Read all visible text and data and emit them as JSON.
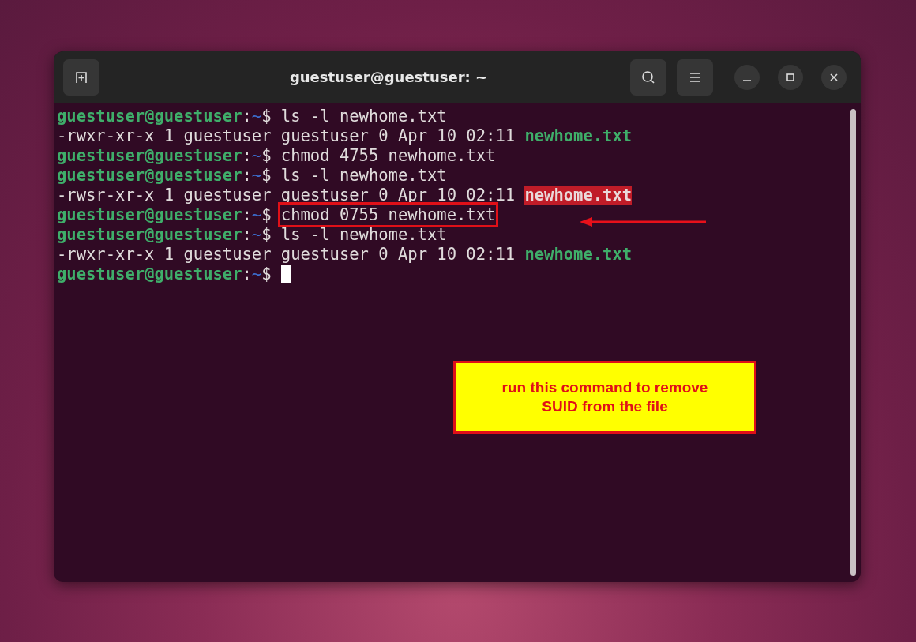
{
  "window": {
    "title": "guestuser@guestuser: ~"
  },
  "terminal": {
    "lines": [
      {
        "kind": "prompt",
        "prompt": {
          "user_host": "guestuser@guestuser",
          "separator": ":",
          "path": "~",
          "symbol": "$"
        },
        "command": "ls -l newhome.txt"
      },
      {
        "kind": "output",
        "text": "-rwxr-xr-x 1 guestuser guestuser 0 Apr 10 02:11",
        "filename": "newhome.txt",
        "file_highlighted": false
      },
      {
        "kind": "prompt",
        "prompt": {
          "user_host": "guestuser@guestuser",
          "separator": ":",
          "path": "~",
          "symbol": "$"
        },
        "command": "chmod 4755 newhome.txt"
      },
      {
        "kind": "prompt",
        "prompt": {
          "user_host": "guestuser@guestuser",
          "separator": ":",
          "path": "~",
          "symbol": "$"
        },
        "command": "ls -l newhome.txt"
      },
      {
        "kind": "output",
        "text": "-rwsr-xr-x 1 guestuser guestuser 0 Apr 10 02:11",
        "filename": "newhome.txt",
        "file_highlighted": true
      },
      {
        "kind": "prompt",
        "prompt": {
          "user_host": "guestuser@guestuser",
          "separator": ":",
          "path": "~",
          "symbol": "$"
        },
        "command": "chmod 0755 newhome.txt",
        "boxed": true
      },
      {
        "kind": "prompt",
        "prompt": {
          "user_host": "guestuser@guestuser",
          "separator": ":",
          "path": "~",
          "symbol": "$"
        },
        "command": "ls -l newhome.txt"
      },
      {
        "kind": "output",
        "text": "-rwxr-xr-x 1 guestuser guestuser 0 Apr 10 02:11",
        "filename": "newhome.txt",
        "file_highlighted": false
      },
      {
        "kind": "prompt",
        "prompt": {
          "user_host": "guestuser@guestuser",
          "separator": ":",
          "path": "~",
          "symbol": "$"
        },
        "cursor": true
      }
    ]
  },
  "annotation": {
    "text": "run this command to remove SUID from the file"
  }
}
